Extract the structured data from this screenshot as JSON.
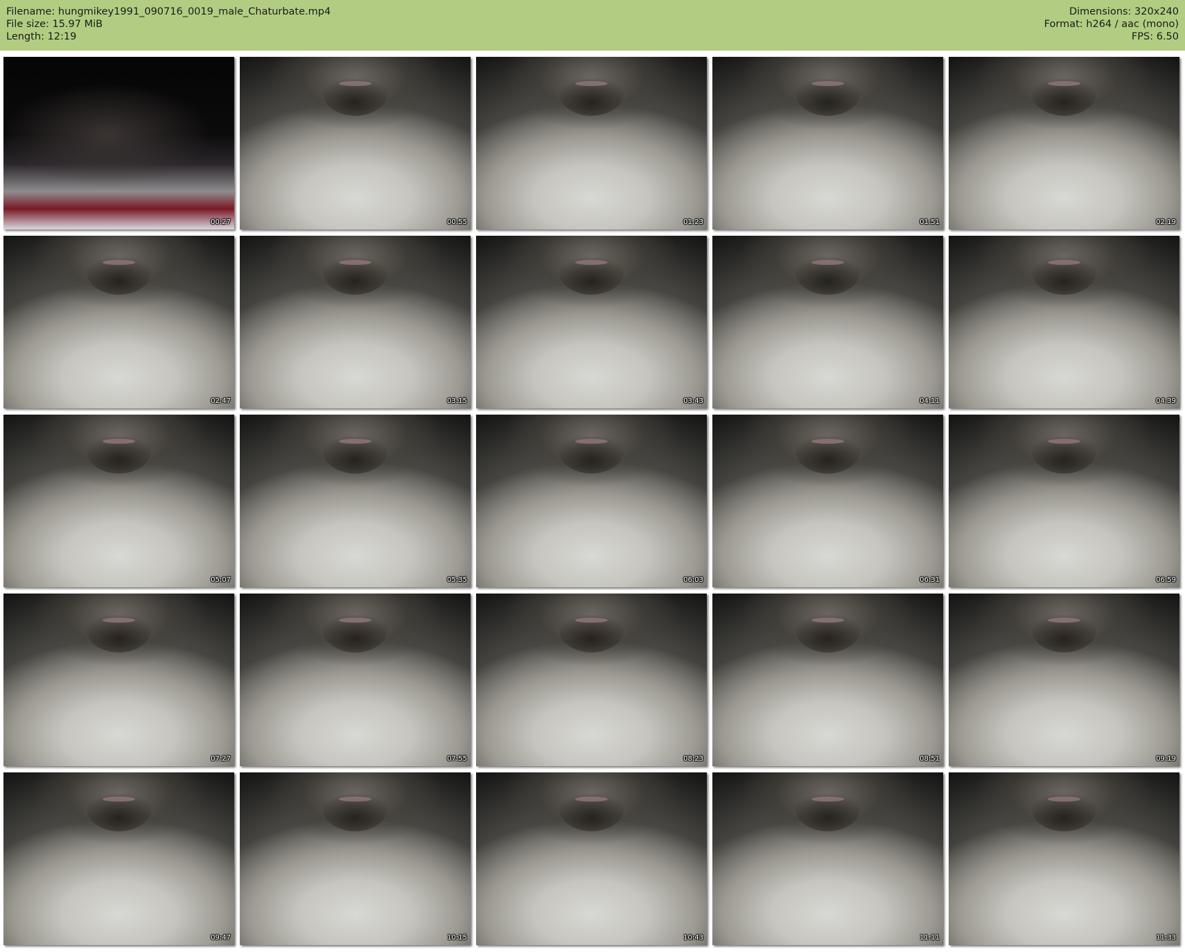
{
  "header": {
    "filename": "Filename: hungmikey1991_090716_0019_male_Chaturbate.mp4",
    "filesize": "File size: 15.97 MiB",
    "length": "Length: 12:19",
    "dimensions": "Dimensions: 320x240",
    "format": "Format: h264 / aac (mono)",
    "fps": "FPS: 6.50"
  },
  "colors": {
    "header_bg": "#b2cd82",
    "timestamp_text": "#ffffff"
  },
  "thumbnails": [
    {
      "time": "00:27"
    },
    {
      "time": "00:55"
    },
    {
      "time": "01:23"
    },
    {
      "time": "01:51"
    },
    {
      "time": "02:19"
    },
    {
      "time": "02:47"
    },
    {
      "time": "03:15"
    },
    {
      "time": "03:43"
    },
    {
      "time": "04:11"
    },
    {
      "time": "04:39"
    },
    {
      "time": "05:07"
    },
    {
      "time": "05:35"
    },
    {
      "time": "06:03"
    },
    {
      "time": "06:31"
    },
    {
      "time": "06:59"
    },
    {
      "time": "07:27"
    },
    {
      "time": "07:55"
    },
    {
      "time": "08:23"
    },
    {
      "time": "08:51"
    },
    {
      "time": "09:19"
    },
    {
      "time": "09:47"
    },
    {
      "time": "10:15"
    },
    {
      "time": "10:43"
    },
    {
      "time": "11:11"
    },
    {
      "time": "11:33"
    }
  ]
}
